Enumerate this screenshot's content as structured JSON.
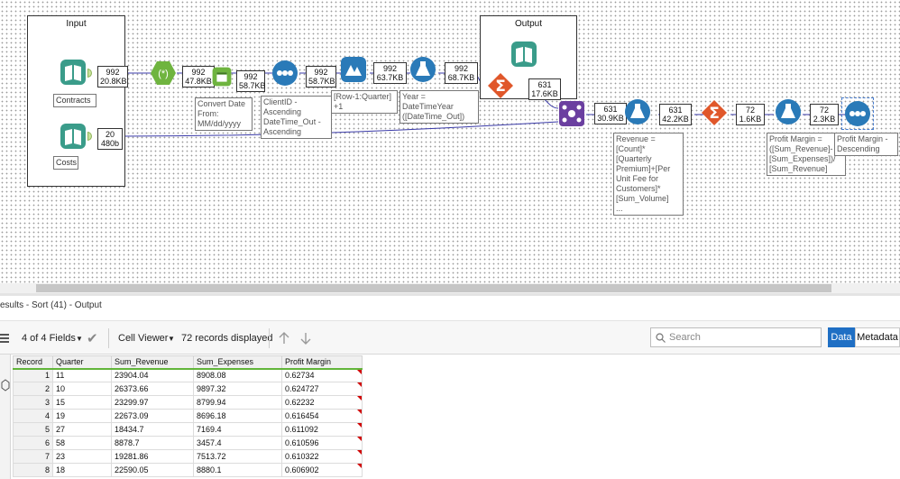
{
  "canvas": {
    "containers": [
      {
        "id": "input",
        "title": "Input"
      },
      {
        "id": "output",
        "title": "Output"
      }
    ],
    "inputs": [
      {
        "name": "contracts",
        "label": "Contracts",
        "records": "992",
        "size": "20.8KB"
      },
      {
        "name": "costs",
        "label": "Costs",
        "records": "20",
        "size": "480b"
      }
    ],
    "tools": [
      {
        "name": "formula-1",
        "records": "992",
        "size": "47.8KB"
      },
      {
        "name": "datetime",
        "records": "992",
        "size": "58.7KB",
        "annotation": "Convert Date\nFrom:\nMM/dd/yyyy"
      },
      {
        "name": "sort-1",
        "records": "992",
        "size": "58.7KB",
        "annotation": "ClientID -\nAscending\nDateTime_Out -\nAscending"
      },
      {
        "name": "multirow",
        "records": "992",
        "size": "63.7KB",
        "annotation": "[Row-1:Quarter]\n+1"
      },
      {
        "name": "formula-2",
        "records": "992",
        "size": "68.7KB",
        "annotation": "Year =\nDateTimeYear\n([DateTime_Out])"
      },
      {
        "name": "summarize-1",
        "records": "631",
        "size": "17.6KB"
      },
      {
        "name": "join",
        "records": "631",
        "size": "30.9KB"
      },
      {
        "name": "formula-3",
        "records": "631",
        "size": "42.2KB",
        "annotation": "Revenue =\n[Count]*\n[Quarterly\nPremium]+[Per\nUnit Fee for\nCustomers]*\n[Sum_Volume]\n..."
      },
      {
        "name": "summarize-2",
        "records": "72",
        "size": "1.6KB"
      },
      {
        "name": "formula-4",
        "records": "72",
        "size": "2.3KB",
        "annotation": "Profit Margin =\n([Sum_Revenue]-\n[Sum_Expenses])/\n[Sum_Revenue]"
      },
      {
        "name": "sort-2",
        "annotation": "Profit Margin -\nDescending"
      }
    ]
  },
  "results": {
    "title": "esults - Sort (41) - Output",
    "fields_label": "4 of 4 Fields",
    "viewer_label": "Cell Viewer",
    "records_label": "72 records displayed",
    "search_placeholder": "Search",
    "data_tab": "Data",
    "metadata_tab": "Metadata",
    "columns": [
      "Record",
      "Quarter",
      "Sum_Revenue",
      "Sum_Expenses",
      "Profit Margin"
    ],
    "rows": [
      [
        "1",
        "11",
        "23904.04",
        "8908.08",
        "0.62734"
      ],
      [
        "2",
        "10",
        "26373.66",
        "9897.32",
        "0.624727"
      ],
      [
        "3",
        "15",
        "23299.97",
        "8799.94",
        "0.62232"
      ],
      [
        "4",
        "19",
        "22673.09",
        "8696.18",
        "0.616454"
      ],
      [
        "5",
        "27",
        "18434.7",
        "7169.4",
        "0.611092"
      ],
      [
        "6",
        "58",
        "8878.7",
        "3457.4",
        "0.610596"
      ],
      [
        "7",
        "23",
        "19281.86",
        "7513.72",
        "0.610322"
      ],
      [
        "8",
        "18",
        "22590.05",
        "8880.1",
        "0.606902"
      ]
    ]
  },
  "colors": {
    "accent": "#1f6fc4",
    "header_underline": "#62b53a",
    "input_tool": "#3a9c8a",
    "formula_tool": "#6fb43f",
    "prep_tool": "#2a7ab8",
    "summarize_tool": "#e0572a",
    "join_tool": "#6b3fa0"
  }
}
